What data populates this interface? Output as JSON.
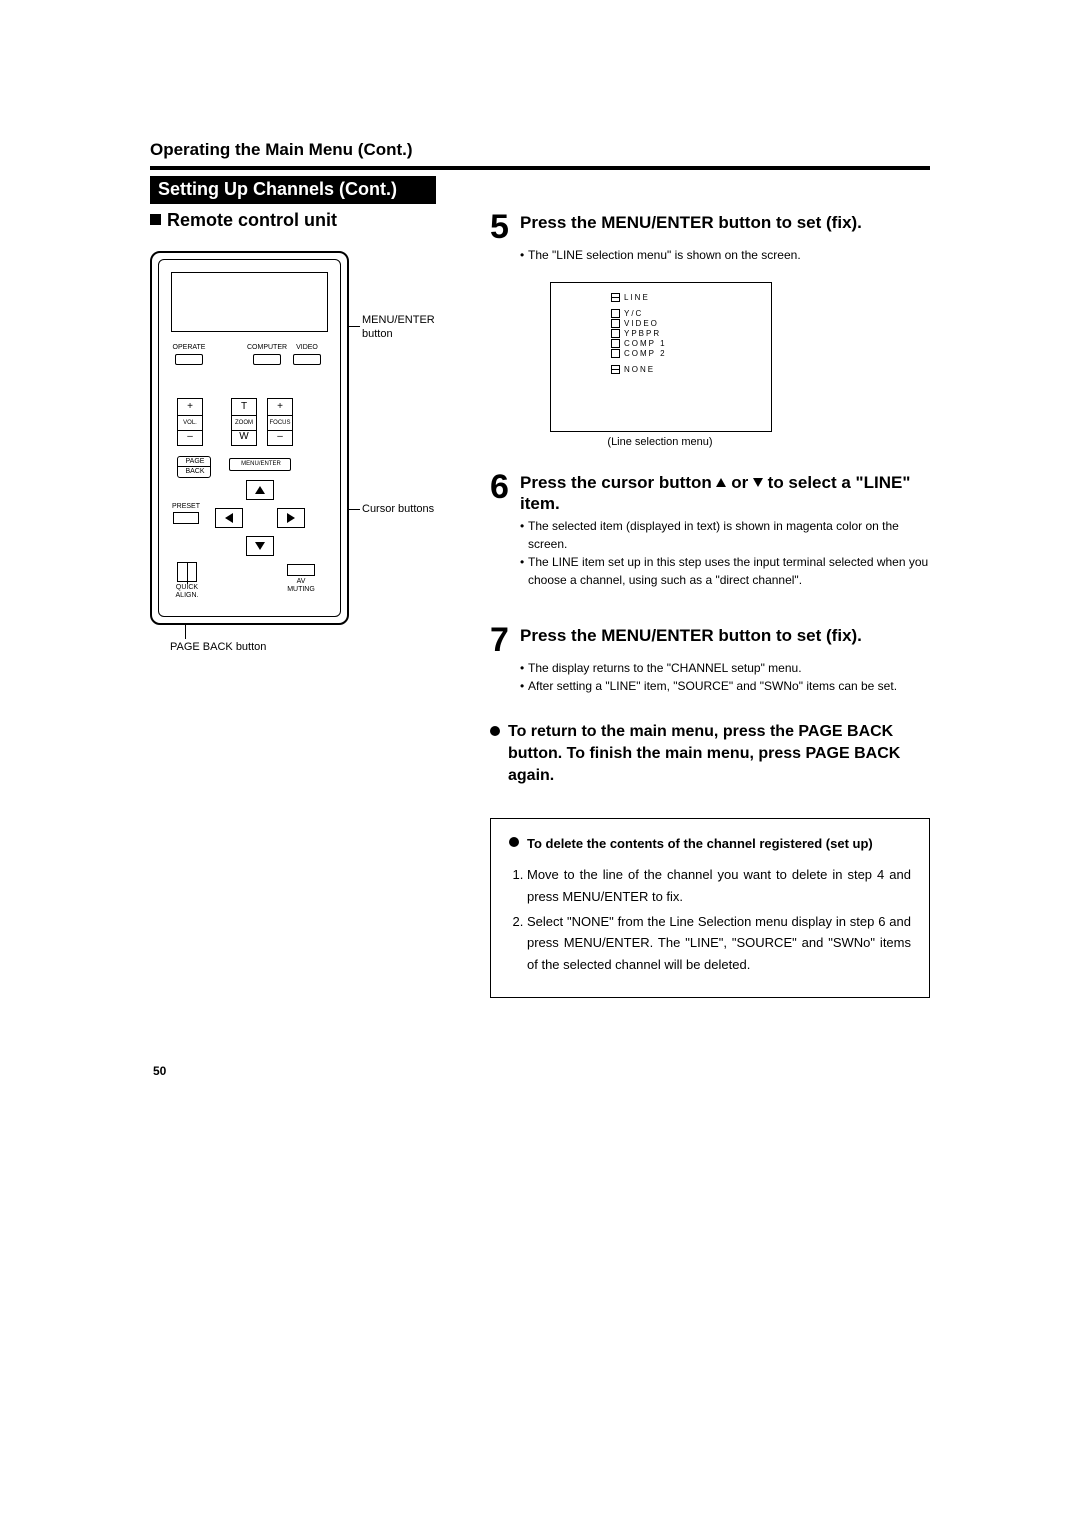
{
  "header": {
    "operating": "Operating the Main Menu (Cont.)",
    "section": "Setting Up Channels (Cont.)"
  },
  "left": {
    "title": "Remote control unit",
    "labels": {
      "menu_enter": "MENU/ENTER button",
      "cursor": "Cursor buttons",
      "page_back": "PAGE BACK button",
      "operate": "OPERATE",
      "computer": "COMPUTER",
      "video": "VIDEO",
      "vol": "VOL.",
      "zoom": "ZOOM",
      "focus": "FOCUS",
      "t": "T",
      "w": "W",
      "plus": "+",
      "minus": "–",
      "pageback_top": "PAGE",
      "pageback_bot": "BACK",
      "menuenter_btn": "MENU/ENTER",
      "preset": "PRESET",
      "quick1": "QUICK",
      "quick2": "ALIGN.",
      "av1": "AV",
      "av2": "MUTING"
    }
  },
  "steps": {
    "s5": {
      "num": "5",
      "title": "Press the MENU/ENTER button to set (fix).",
      "b1": "The \"LINE selection menu\" is shown on the screen."
    },
    "screen": {
      "line": "LINE",
      "yc": "Y/C",
      "video": "VIDEO",
      "ypbpr": "YPBPR",
      "comp1": "COMP 1",
      "comp2": "COMP 2",
      "none": "NONE",
      "caption": "(Line selection menu)"
    },
    "s6": {
      "num": "6",
      "title_a": "Press the cursor button ",
      "title_b": " or ",
      "title_c": " to select a \"LINE\" item.",
      "b1": "The selected item (displayed in text) is shown in magenta color on the screen.",
      "b2": "The LINE item set up in this step uses the input terminal selected when you choose a channel, using such as a \"direct channel\"."
    },
    "s7": {
      "num": "7",
      "title": "Press the MENU/ENTER button to set (fix).",
      "b1": "The display returns to the \"CHANNEL setup\" menu.",
      "b2": "After setting a \"LINE\" item, \"SOURCE\" and \"SWNo\" items can be set."
    },
    "return": "To return to the main menu, press the PAGE BACK button. To finish the main menu, press PAGE BACK again.",
    "delete": {
      "head": "To delete the contents of the channel registered (set up)",
      "i1": "Move to the line of the channel you want to delete in step 4 and press MENU/ENTER to fix.",
      "i2": "Select \"NONE\" from the Line Selection menu display in step 6 and press MENU/ENTER. The \"LINE\", \"SOURCE\" and \"SWNo\" items of the selected channel will be deleted."
    }
  },
  "page_number": "50"
}
